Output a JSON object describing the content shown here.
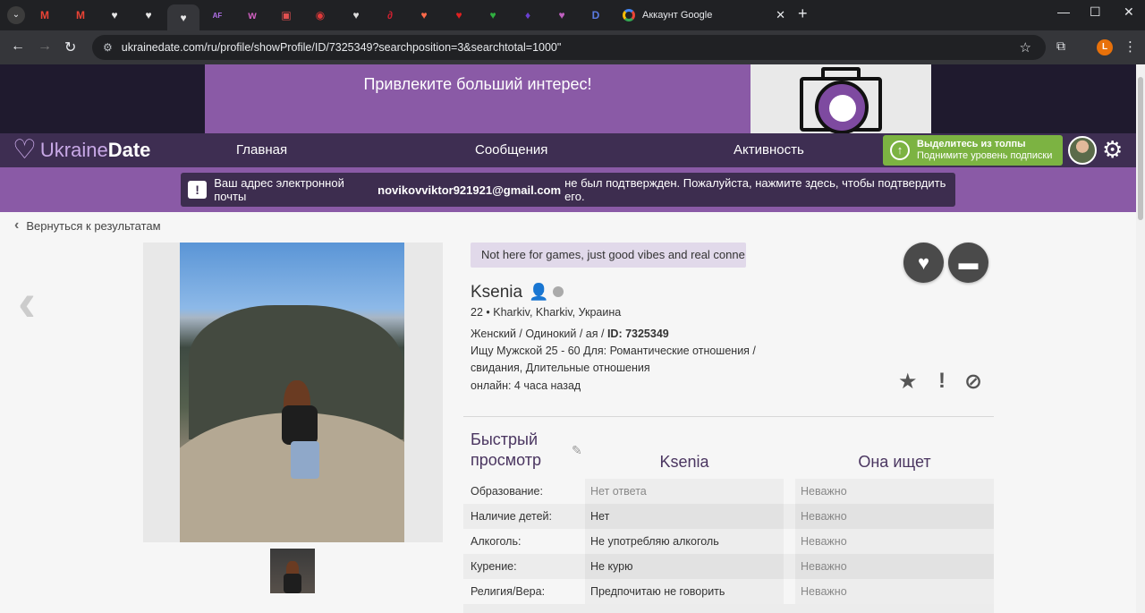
{
  "browser": {
    "tabs": [
      {
        "icon": "menu-icon",
        "glyph": "⌄",
        "color": "#e8eaed"
      },
      {
        "icon": "gmail-icon",
        "glyph": "M",
        "color": "#ea4335"
      },
      {
        "icon": "gmail-icon",
        "glyph": "M",
        "color": "#ea4335"
      },
      {
        "icon": "heart-outline-icon",
        "glyph": "♥",
        "color": "#e8e8e8"
      },
      {
        "icon": "heart-outline-icon",
        "glyph": "♥",
        "color": "#e8e8e8"
      },
      {
        "icon": "heart-outline-icon",
        "glyph": "♥",
        "color": "#e8e8e8"
      },
      {
        "icon": "af-icon",
        "glyph": "AF",
        "color": "#b070e8"
      },
      {
        "icon": "ww-icon",
        "glyph": "ᴡ",
        "color": "#d060c0"
      },
      {
        "icon": "card-icon",
        "glyph": "▣",
        "color": "#e05050"
      },
      {
        "icon": "lips-icon",
        "glyph": "◉",
        "color": "#e03a3a"
      },
      {
        "icon": "heart-shield-icon",
        "glyph": "♥",
        "color": "#dddddd"
      },
      {
        "icon": "swirl-icon",
        "glyph": "∂",
        "color": "#d02030"
      },
      {
        "icon": "heart-icon",
        "glyph": "♥",
        "color": "#ff6a4a"
      },
      {
        "icon": "heart-box-icon",
        "glyph": "♥",
        "color": "#e02020"
      },
      {
        "icon": "leaf-icon",
        "glyph": "♥",
        "color": "#30b040"
      },
      {
        "icon": "bolt-icon",
        "glyph": "♦",
        "color": "#6a40d0"
      },
      {
        "icon": "heart-purple-icon",
        "glyph": "♥",
        "color": "#c060c0"
      },
      {
        "icon": "d-icon",
        "glyph": "D",
        "color": "#5a7ae0"
      }
    ],
    "active_tab": {
      "title": "Аккаунт Google",
      "close": "✕"
    },
    "new_tab": "+",
    "window_controls": {
      "minimize": "—",
      "maximize": "☐",
      "close": "✕"
    },
    "nav": {
      "back": "←",
      "forward": "→",
      "reload": "↻"
    },
    "url": "ukrainedate.com/ru/profile/showProfile/ID/7325349?searchposition=3&searchtotal=1000\"",
    "profile_initial": "L"
  },
  "ad": {
    "text": "Привлеките больший интерес!"
  },
  "site_nav": {
    "logo_part1": "Ukraine",
    "logo_part2": "Date",
    "links": [
      "Главная",
      "Сообщения",
      "Активность"
    ],
    "promo_line1": "Выделитесь из толпы",
    "promo_line2": "Поднимите уровень подписки"
  },
  "verify": {
    "before": "Ваш адрес электронной почты",
    "email": "novikovviktor921921@gmail.com",
    "after": "не был подтвержден. Пожалуйста, нажмите здесь, чтобы подтвердить его."
  },
  "back_label": "Вернуться к результатам",
  "profile": {
    "tagline": "Not here for games, just good vibes and real conne",
    "name": "Ksenia",
    "location": "22 • Kharkiv, Kharkiv, Украина",
    "line_gender": "Женский / Одинокий / ая /",
    "id_label": "ID: 7325349",
    "seeking": "Ищу Мужской 25 - 60 Для: Романтические отношения / свидания, Длительные отношения",
    "online": "онлайн: 4 часа назад"
  },
  "quickview": {
    "title": "Быстрый просмотр",
    "col_self": "Ksenia",
    "col_wants": "Она ищет",
    "rows": [
      {
        "label": "Образование:",
        "value": "Нет ответа",
        "wants": "Неважно"
      },
      {
        "label": "Наличие детей:",
        "value": "Нет",
        "wants": "Неважно"
      },
      {
        "label": "Алкоголь:",
        "value": "Не употребляю алкоголь",
        "wants": "Неважно"
      },
      {
        "label": "Курение:",
        "value": "Не курю",
        "wants": "Неважно"
      },
      {
        "label": "Религия/Вера:",
        "value": "Предпочитаю не говорить",
        "wants": "Неважно"
      }
    ]
  }
}
